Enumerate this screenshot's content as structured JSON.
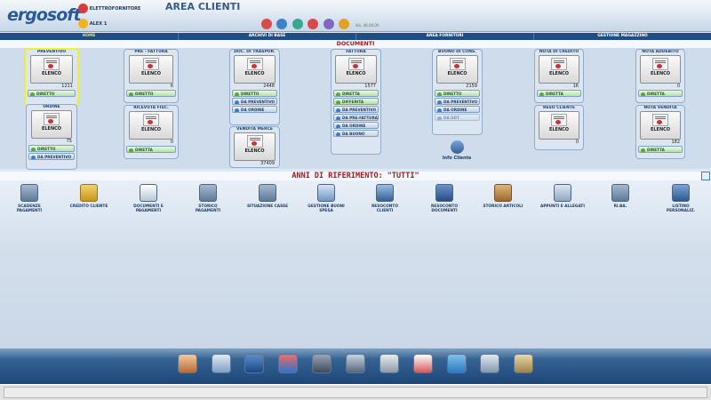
{
  "app": {
    "logo": "ergosoft",
    "company": "ELETTROFORNITORE",
    "user": "ALEX 1",
    "area_title": "AREA CLIENTI",
    "version": "Ver. 46.00.00"
  },
  "nav": [
    "HOME",
    "ARCHIVI DI BASE",
    "AREA FORNITORI",
    "GESTIONE MAGAZZINO"
  ],
  "documents": {
    "title": "DOCUMENTI",
    "preventivo": {
      "title": "PREVENTIVO",
      "btn": "ELENCO",
      "count": "1211"
    },
    "ordine": {
      "title": "ORDINE",
      "btn": "ELENCO",
      "count": "75",
      "sub": [
        "DIRETTO",
        "DA PREVENTIVO"
      ]
    },
    "prefattura": {
      "title": "PRE - FATTURA",
      "btn": "ELENCO",
      "count": "6",
      "sub": [
        "DIRETTO"
      ]
    },
    "ricevuta": {
      "title": "RICEVUTA FISC.",
      "btn": "ELENCO",
      "count": "0",
      "sub": [
        "DIRETTA"
      ]
    },
    "ddt": {
      "title": "DOC. DI TRASPOR.",
      "btn": "ELENCO",
      "count": "2448",
      "sub": [
        "DIRETTO",
        "DA PREVENTIVO",
        "DA ORDINE"
      ]
    },
    "vendita": {
      "title": "VENDITA MERCE",
      "btn": "ELENCO",
      "count": "37409"
    },
    "fattura": {
      "title": "FATTURA",
      "btn": "ELENCO",
      "count": "1577",
      "sub": [
        "DIRETTA",
        "DIFFERITA",
        "DA PREVENTIVO",
        "DA PRE-FATTURA",
        "DA ORDINE",
        "DA BUONO"
      ]
    },
    "buono": {
      "title": "BUONO DI CONS.",
      "btn": "ELENCO",
      "count": "2159",
      "sub": [
        "DIRETTO",
        "DA PREVENTIVO",
        "DA ORDINE",
        "DA DDT"
      ]
    },
    "info": "Info Cliente",
    "notacredito": {
      "title": "NOTA DI CREDITO",
      "btn": "ELENCO",
      "count": "16",
      "sub": [
        "DIRETTA"
      ]
    },
    "reso": {
      "title": "RESO CLIENTE",
      "btn": "ELENCO",
      "count": "0"
    },
    "notaaddebito": {
      "title": "NOTA ADDEBITO",
      "btn": "ELENCO",
      "count": "0",
      "sub": [
        "DIRETTA"
      ]
    },
    "notavendita": {
      "title": "NOTA VENDITA",
      "btn": "ELENCO",
      "count": "182",
      "sub": [
        "DIRETTA"
      ]
    }
  },
  "anni": "ANNI DI RIFERIMENTO: \"TUTTI\"",
  "reports": [
    "SCADENZE PAGAMENTI",
    "CREDITO CLIENTE",
    "DOCUMENTI E PAGAMENTI",
    "STORICO PAGAMENTI",
    "SITUAZIONE CASSE",
    "GESTIONE BUONI SPESA",
    "RESOCONTO CLIENTI",
    "RESOCONTO DOCUMENTI",
    "STORICO ARTICOLI",
    "APPUNTI E ALLEGATI",
    "RI.BA.",
    "LISTINO PERSONALIZ."
  ],
  "colors": {
    "accent": "#1f4e86",
    "title_red": "#a01818",
    "highlight": "#f0f028"
  }
}
